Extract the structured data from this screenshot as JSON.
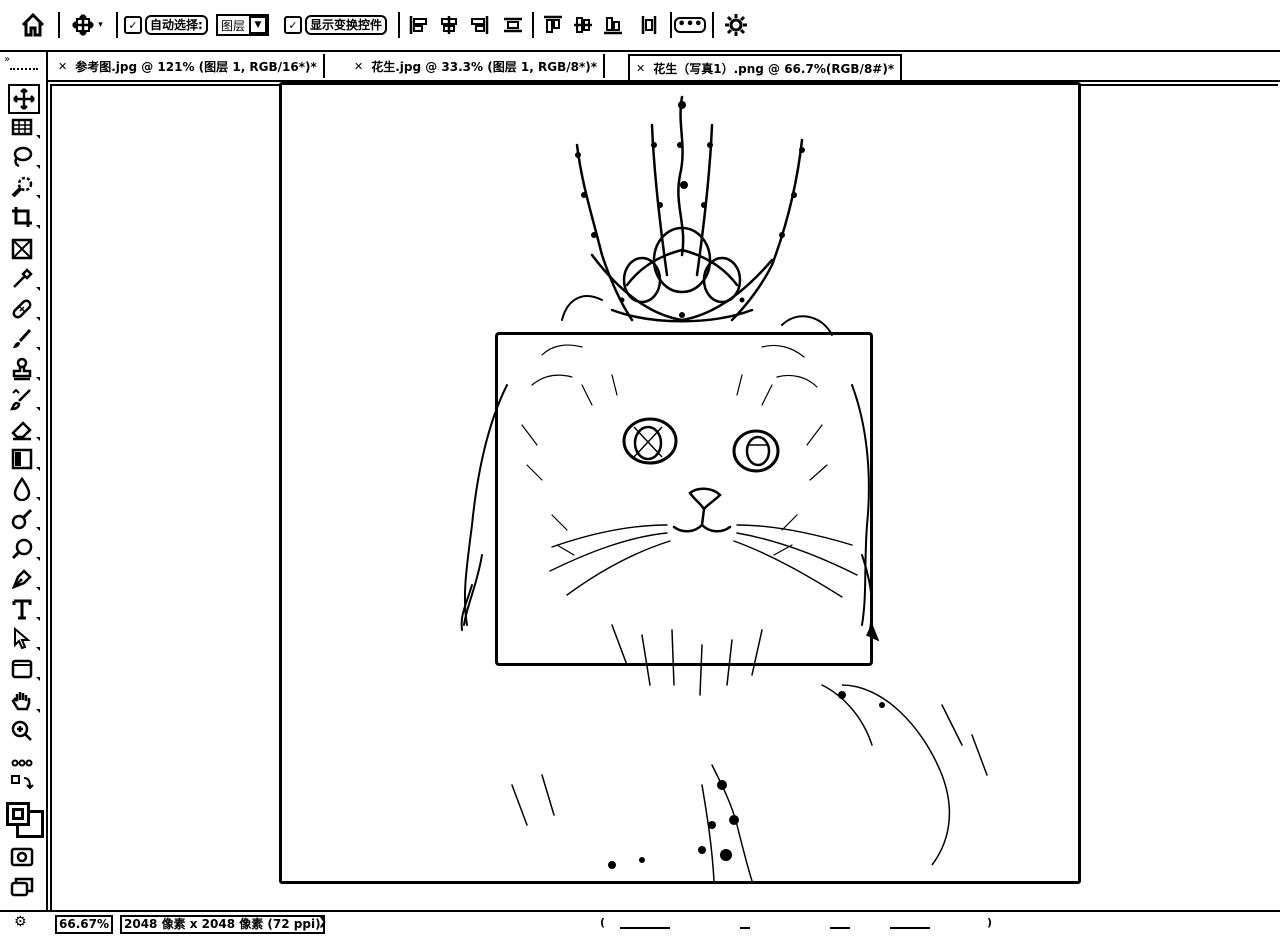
{
  "options_bar": {
    "auto_select_label": "自动选择:",
    "auto_select_checked": true,
    "layer_select_value": "图层",
    "show_transform_label": "显示变换控件",
    "show_transform_checked": true,
    "more_label": "•••"
  },
  "tabs": [
    {
      "label": "参考图.jpg @ 121% (图层 1, RGB/16*)*",
      "active": false
    },
    {
      "label": "花生.jpg @ 33.3% (图层 1, RGB/8*)*",
      "active": false
    },
    {
      "label": "花生（写真1）.png @ 66.7%(RGB/8#)*",
      "active": true
    }
  ],
  "status": {
    "zoom": "66.67%",
    "doc_size": "2048 像素 x 2048 像素 (72 ppi)",
    "arrow": "❯"
  },
  "icons": {
    "home": "home-icon",
    "move": "move-icon",
    "settings": "gear-icon"
  }
}
